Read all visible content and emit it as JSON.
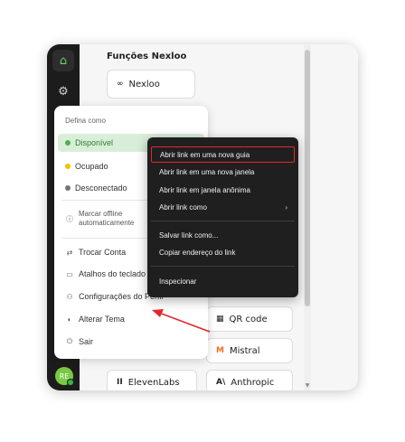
{
  "panel": {
    "section_title": "Funções Nexloo"
  },
  "cards": {
    "nexloo": "Nexloo",
    "qrcode": "QR code",
    "mistral": "Mistral",
    "elevenlabs": "ElevenLabs",
    "anthropic": "Anthropic"
  },
  "avatar": {
    "initials": "RE"
  },
  "status_menu": {
    "heading": "Defina como",
    "items": [
      {
        "label": "Disponível",
        "color": "#4caf50"
      },
      {
        "label": "Ocupado",
        "color": "#f5c000"
      },
      {
        "label": "Desconectado",
        "color": "#757575"
      }
    ],
    "offline_label": "Marcar offline automaticamente",
    "switch_account": "Trocar Conta",
    "shortcuts": "Atalhos do teclado",
    "profile_settings": "Configurações do Perfil",
    "change_theme": "Alterar Tema",
    "logout": "Sair"
  },
  "context_menu": {
    "items": [
      "Abrir link em uma nova guia",
      "Abrir link em uma nova janela",
      "Abrir link em janela anônima",
      "Abrir link como",
      "Salvar link como...",
      "Copiar endereço do link",
      "Inspecionar"
    ],
    "highlight_color": "#e2282d"
  },
  "annotation": {
    "arrow_color": "#e2282d"
  }
}
